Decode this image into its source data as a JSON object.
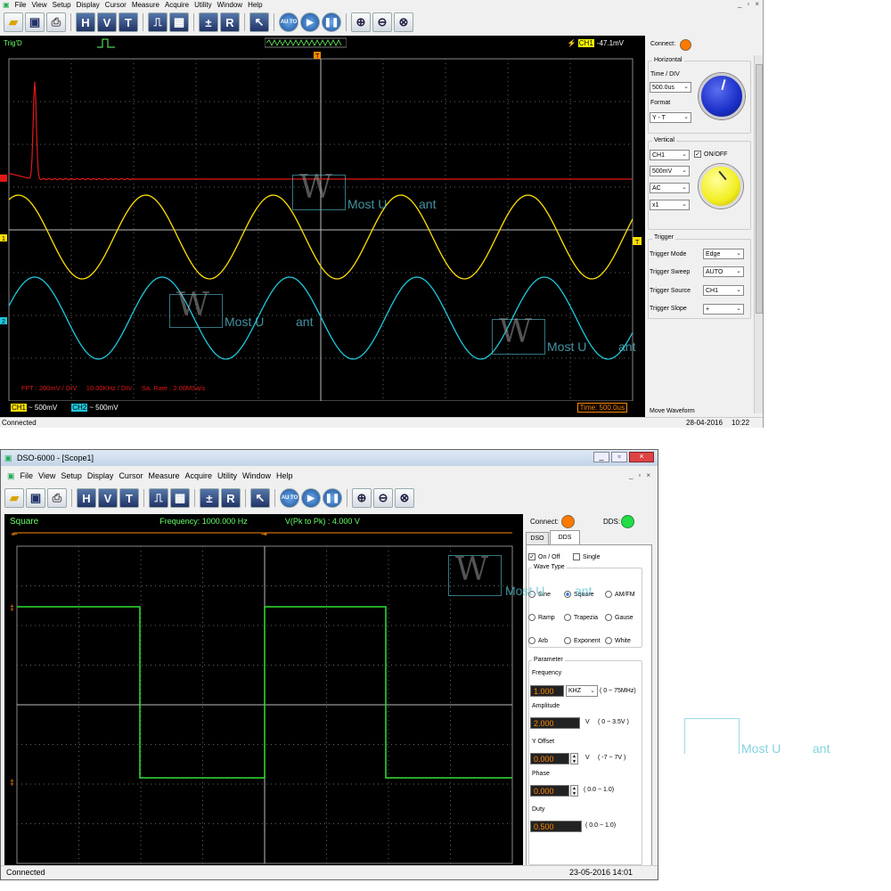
{
  "win1": {
    "menu": [
      "File",
      "View",
      "Setup",
      "Display",
      "Cursor",
      "Measure",
      "Acquire",
      "Utility",
      "Window",
      "Help"
    ],
    "sys_buttons": [
      "_",
      "▫",
      "×"
    ],
    "toolbar_letters": {
      "h": "H",
      "v": "V",
      "t": "T",
      "r": "R",
      "auto": "AU TO"
    },
    "scope_top": {
      "trig_status": "Trig'D",
      "trig_channel": "CH1",
      "trig_level": "-47.1mV",
      "trig_marker": "T"
    },
    "overlay": {
      "fft": "FFT : 200mV / DIV     10.00KHz / DIV     Sa. Rate : 2.00MSa/s"
    },
    "bottom": {
      "ch1": "CH1",
      "ch1_scale": "~ 500mV",
      "ch2": "CH2",
      "ch2_scale": "~ 500mV",
      "time": "Time: 500.0us"
    },
    "markers": {
      "ch1": "1",
      "ch2": "2",
      "trig_right": "T"
    },
    "panel": {
      "connect_label": "Connect:",
      "horizontal": {
        "title": "Horizontal",
        "time_div_label": "Time / DIV",
        "time_div": "500.0us",
        "format_label": "Format",
        "format": "Y - T"
      },
      "vertical": {
        "title": "Vertical",
        "channel": "CH1",
        "onoff_label": "ON/OFF",
        "volts": "500mV",
        "coupling": "AC",
        "probe": "x1"
      },
      "trigger": {
        "title": "Trigger",
        "rows": [
          {
            "label": "Trigger Mode",
            "value": "Edge"
          },
          {
            "label": "Trigger Sweep",
            "value": "AUTO"
          },
          {
            "label": "Trigger Source",
            "value": "CH1"
          },
          {
            "label": "Trigger Slope",
            "value": "+"
          }
        ]
      },
      "move_waveform": "Move Waveform"
    },
    "status": {
      "left": "Connected",
      "date": "28-04-2016",
      "time": "10:22"
    },
    "colors": {
      "ch1": "#ffe000",
      "ch2": "#1ec8dc",
      "fft": "#e01818",
      "knob_h": "#1a2fc8",
      "knob_v": "#f2ee20",
      "connect": "#ff7a00"
    }
  },
  "win2": {
    "title": "DSO-6000 - [Scope1]",
    "menu": [
      "File",
      "View",
      "Setup",
      "Display",
      "Cursor",
      "Measure",
      "Acquire",
      "Utility",
      "Window",
      "Help"
    ],
    "sys_buttons": [
      "_",
      "▫",
      "×"
    ],
    "header": {
      "wave": "Square",
      "frequency": "Frequency: 1000.000 Hz",
      "vpp": "V(Pk to Pk) : 4.000 V"
    },
    "panel": {
      "connect_label": "Connect:",
      "dds_label": "DDS:",
      "tabs": [
        "DSO",
        "DDS"
      ],
      "onoff": "On / Off",
      "single": "Single",
      "wave_type_title": "Wave Type",
      "wave_types": [
        {
          "label": "Sine",
          "on": false
        },
        {
          "label": "Square",
          "on": true
        },
        {
          "label": "AM/FM",
          "on": false
        },
        {
          "label": "Ramp",
          "on": false
        },
        {
          "label": "Trapezia",
          "on": false
        },
        {
          "label": "Gause",
          "on": false
        },
        {
          "label": "Arb",
          "on": false
        },
        {
          "label": "Exponent",
          "on": false
        },
        {
          "label": "White",
          "on": false
        }
      ],
      "parameter_title": "Parameter",
      "frequency_label": "Frequency",
      "frequency_value": "1.000",
      "frequency_unit": "KHZ",
      "frequency_range": "( 0 ~ 75MHz)",
      "amplitude_label": "Amplitude",
      "amplitude_value": "2.000",
      "amplitude_unit": "V",
      "amplitude_range": "( 0 ~ 3.5V )",
      "offset_label": "Y Offset",
      "offset_value": "0.000",
      "offset_unit": "V",
      "offset_range": "( -7 ~ 7V )",
      "phase_label": "Phase",
      "phase_value": "0.000",
      "phase_range": "( 0.0 ~ 1.0)",
      "duty_label": "Duty",
      "duty_value": "0.500",
      "duty_range": "( 0.0 ~ 1.0)"
    },
    "status": {
      "left": "Connected",
      "datetime": "23-05-2016   14:01"
    },
    "colors": {
      "wave": "#33e033",
      "connect": "#ff7a00",
      "dds": "#22dd44"
    }
  },
  "watermark": {
    "text": "Most U",
    "text2": "ant",
    "letter": "W"
  }
}
